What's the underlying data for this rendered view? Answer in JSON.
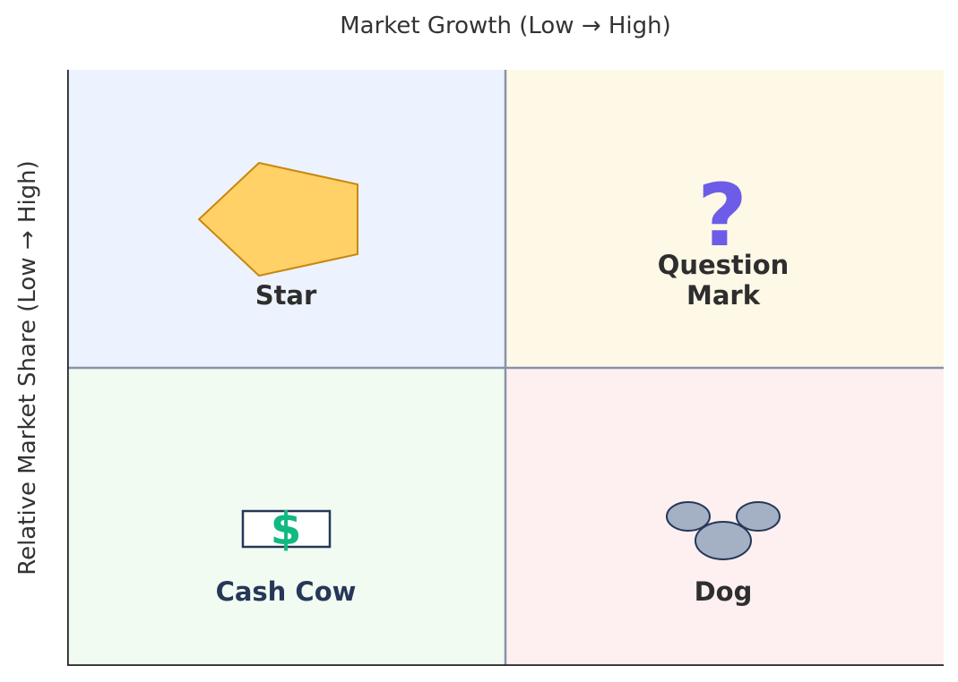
{
  "diagram": {
    "x_axis_label": "Market Growth (Low → High)",
    "y_axis_label": "Relative Market Share (Low → High)",
    "quadrants": [
      {
        "id": "star",
        "label": "Star",
        "icon": "pentagon-icon",
        "fill": "#edf3fe",
        "icon_color": "#ffd166",
        "icon_stroke": "#c98710"
      },
      {
        "id": "question-mark",
        "label": "Question Mark",
        "label_line1": "Question",
        "label_line2": "Mark",
        "icon": "question-mark-icon",
        "glyph": "?",
        "fill": "#fef8e7",
        "icon_color": "#6c5ce7"
      },
      {
        "id": "cash-cow",
        "label": "Cash Cow",
        "icon": "dollar-bill-icon",
        "glyph": "$",
        "fill": "#f1fbf1",
        "icon_color": "#10b981",
        "label_color": "#263759"
      },
      {
        "id": "dog",
        "label": "Dog",
        "icon": "paw-icon",
        "fill": "#fef0f0",
        "icon_color": "#a4b0c3",
        "icon_stroke": "#263759"
      }
    ],
    "divider_color": "#8793a7",
    "axis_color": "#222222"
  }
}
